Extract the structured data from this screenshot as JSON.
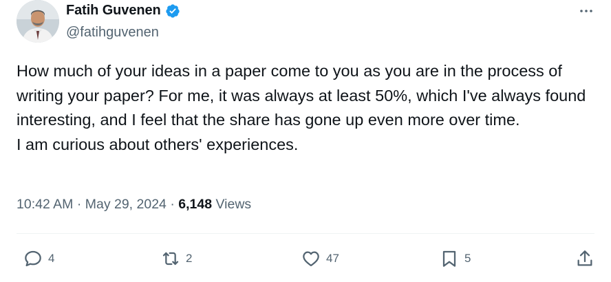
{
  "author": {
    "display_name": "Fatih Guvenen",
    "handle": "@fatihguvenen",
    "verified": true,
    "verified_color": "#1d9bf0"
  },
  "tweet": {
    "paragraphs": [
      "How much of your ideas in a paper come to you as you are in the process of writing your paper? For me, it was always at least 50%, which I've always found interesting, and I feel that the share has gone up even more over time.",
      "I am curious about others' experiences."
    ]
  },
  "meta": {
    "time": "10:42 AM",
    "separator": "·",
    "date": "May 29, 2024",
    "views_count": "6,148",
    "views_label": "Views"
  },
  "actions": {
    "reply_count": "4",
    "retweet_count": "2",
    "like_count": "47",
    "bookmark_count": "5"
  },
  "icons": {
    "more": "more-horizontal-icon",
    "reply": "reply-icon",
    "retweet": "retweet-icon",
    "like": "heart-icon",
    "bookmark": "bookmark-icon",
    "share": "share-icon",
    "verified": "verified-badge-icon"
  },
  "colors": {
    "text_primary": "#0f1419",
    "text_secondary": "#536471",
    "divider": "#eff3f4"
  }
}
